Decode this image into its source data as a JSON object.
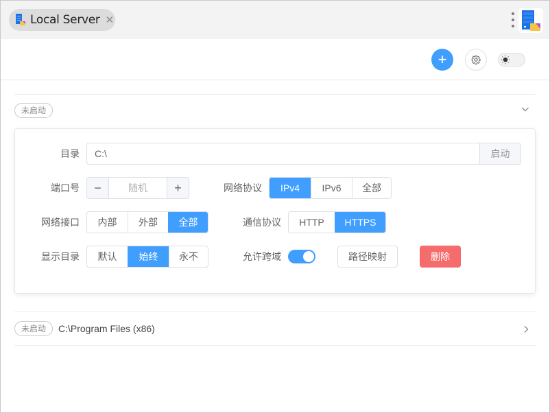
{
  "titlebar": {
    "tab_title": "Local Server",
    "tab_icon": "server-folder-icon",
    "close_icon": "close-icon",
    "menu_icon": "more-vertical-icon",
    "app_logo": "server-folder-icon"
  },
  "toolbar": {
    "add_label": "+",
    "add_icon": "plus-icon",
    "settings_icon": "gear-icon",
    "theme_icon": "sun-icon",
    "theme_dark_mode": false
  },
  "servers": [
    {
      "status": "未启动",
      "expanded": true,
      "expand_icon": "chevron-down-icon",
      "directory_label": "目录",
      "directory_value": "C:\\",
      "start_label": "启动",
      "port_label": "端口号",
      "port_minus": "−",
      "port_placeholder": "随机",
      "port_plus": "+",
      "net_protocol_label": "网络协议",
      "net_protocol_options": [
        "IPv4",
        "IPv6",
        "全部"
      ],
      "net_protocol_selected": "IPv4",
      "interface_label": "网络接口",
      "interface_options": [
        "内部",
        "外部",
        "全部"
      ],
      "interface_selected": "全部",
      "comm_protocol_label": "通信协议",
      "comm_protocol_options": [
        "HTTP",
        "HTTPS"
      ],
      "comm_protocol_selected": "HTTPS",
      "show_dir_label": "显示目录",
      "show_dir_options": [
        "默认",
        "始终",
        "永不"
      ],
      "show_dir_selected": "始终",
      "cors_label": "允许跨域",
      "cors_enabled": true,
      "path_mapping_label": "路径映射",
      "delete_label": "删除"
    },
    {
      "status": "未启动",
      "expanded": false,
      "path": "C:\\Program Files (x86)",
      "expand_icon": "chevron-right-icon"
    }
  ],
  "colors": {
    "primary": "#409eff",
    "danger": "#f56c6c",
    "border": "#dcdfe6",
    "text": "#606266"
  }
}
